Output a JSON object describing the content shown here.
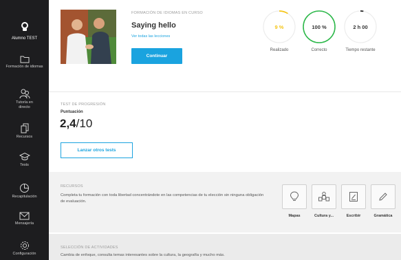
{
  "sidebar": {
    "user_name": "Alumno TEST",
    "items": [
      {
        "label": "Formación de idiomas",
        "icon": "folder-icon"
      },
      {
        "label": "Tutoría en directo",
        "icon": "people-icon"
      },
      {
        "label": "Recursos",
        "icon": "documents-icon"
      },
      {
        "label": "Tests",
        "icon": "graduation-cap-icon"
      },
      {
        "label": "Recapitulación",
        "icon": "pie-chart-icon"
      },
      {
        "label": "Mensajería",
        "icon": "envelope-icon"
      },
      {
        "label": "Configuración",
        "icon": "gear-icon"
      }
    ]
  },
  "course": {
    "caption": "FORMACIÓN DE IDIOMAS EN CURSO",
    "title": "Saying hello",
    "all_lessons_link": "Ver todas las lecciones",
    "continue_button": "Continuar",
    "image_icon": "handshake-photo"
  },
  "stats": [
    {
      "value": "9 %",
      "label": "Realizado",
      "color": "#f5c518",
      "fraction": 0.09
    },
    {
      "value": "100 %",
      "label": "Correcto",
      "color": "#2db84a",
      "fraction": 1.0
    },
    {
      "value": "2 h 00",
      "label": "Tiempo restante",
      "color": "#222222",
      "fraction": 0.03
    }
  ],
  "progress_test": {
    "caption": "TEST DE PROGRESIÓN",
    "score_label": "Puntuación",
    "score": "2,4",
    "score_max": "/10",
    "button": "Lanzar otros tests"
  },
  "resources": {
    "caption": "RECURSOS",
    "description": "Completa tu formación con toda libertad concentrándote en las competencias de tu elección sin ninguna obligación de evaluación.",
    "tools": [
      {
        "label": "Mapas",
        "icon": "lightbulb-icon"
      },
      {
        "label": "Cultura y...",
        "icon": "people-group-icon"
      },
      {
        "label": "Escribir",
        "icon": "write-icon"
      },
      {
        "label": "Gramática",
        "icon": "pencil-icon"
      }
    ]
  },
  "activities": {
    "caption": "SELECCIÓN DE ACTIVIDADES",
    "description": "Cambia de enfoque, consulta temas interesantes sobre la cultura, la geografía y mucho más."
  },
  "colors": {
    "accent": "#1aa3df",
    "sidebar_bg": "#1d1d1f"
  }
}
